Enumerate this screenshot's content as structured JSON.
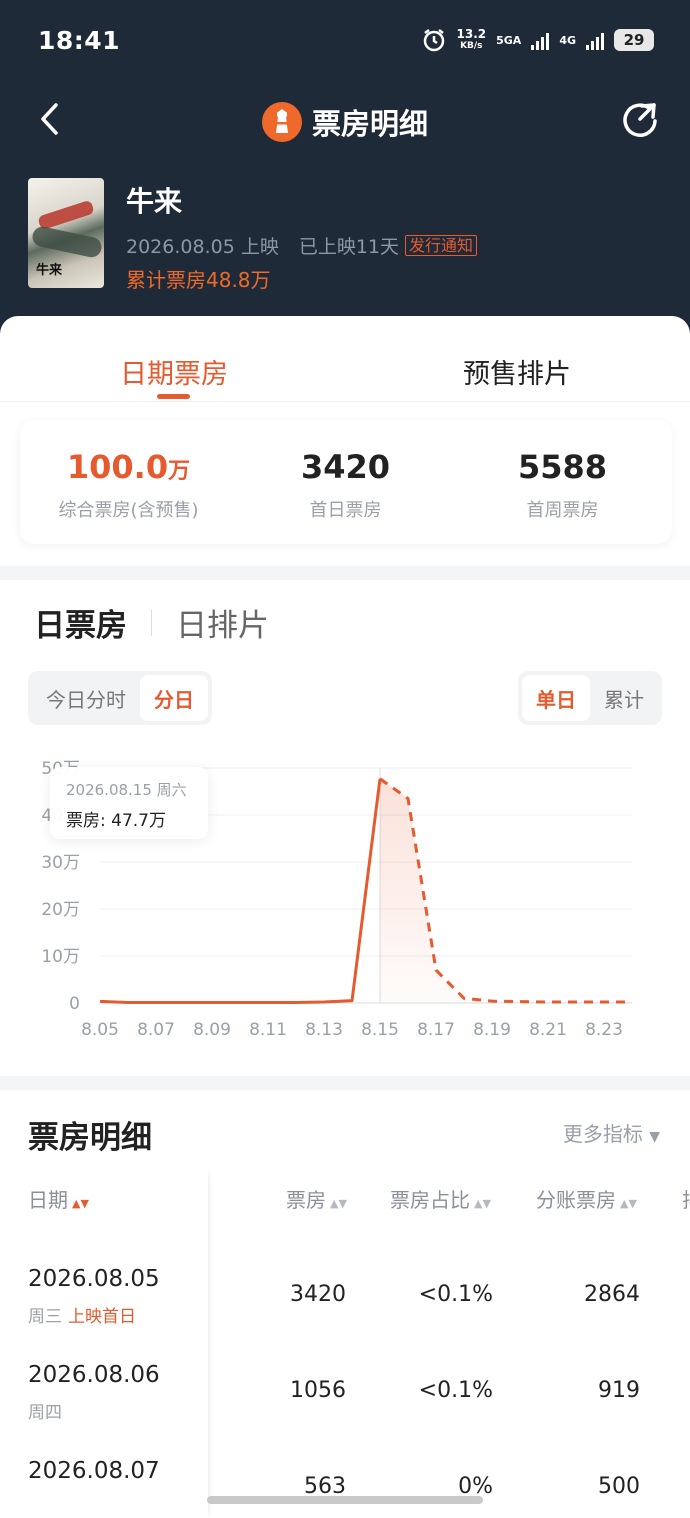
{
  "status_bar": {
    "time": "18:41",
    "speed_value": "13.2",
    "speed_unit": "KB/s",
    "network1": "5GA",
    "network2": "4G",
    "battery": "29"
  },
  "nav": {
    "title": "票房明细"
  },
  "movie": {
    "name": "牛来",
    "release": "2026.08.05 上映",
    "days": "已上映11天",
    "notice": "发行通知",
    "total": "累计票房48.8万",
    "poster_text": "牛来"
  },
  "tabs": {
    "active": "日期票房",
    "inactive": "预售排片"
  },
  "stats": [
    {
      "value": "100.0",
      "unit": "万",
      "label": "综合票房(含预售)"
    },
    {
      "value": "3420",
      "unit": "",
      "label": "首日票房"
    },
    {
      "value": "5588",
      "unit": "",
      "label": "首周票房"
    }
  ],
  "chart_tabs": {
    "a": "日票房",
    "b": "日排片"
  },
  "seg_left": [
    "今日分时",
    "分日"
  ],
  "seg_right": [
    "单日",
    "累计"
  ],
  "tooltip": {
    "date": "2026.08.15 周六",
    "value": "票房: 47.7万"
  },
  "chart_data": {
    "type": "line",
    "y_tick_labels": [
      "0",
      "10万",
      "20万",
      "30万",
      "40万",
      "50万"
    ],
    "ylim": [
      0,
      50
    ],
    "x_tick_labels": [
      "8.05",
      "8.07",
      "8.09",
      "8.11",
      "8.13",
      "8.15",
      "8.17",
      "8.19",
      "8.21",
      "8.23"
    ],
    "x": [
      "8.05",
      "8.06",
      "8.07",
      "8.08",
      "8.09",
      "8.10",
      "8.11",
      "8.12",
      "8.13",
      "8.14",
      "8.15",
      "8.16",
      "8.17",
      "8.18",
      "8.19",
      "8.20",
      "8.21",
      "8.22",
      "8.23",
      "8.24"
    ],
    "series": [
      {
        "values": [
          0.34,
          0.11,
          0.1,
          0.1,
          0.1,
          0.1,
          0.1,
          0.1,
          0.2,
          0.5,
          47.7,
          null,
          null,
          null,
          null,
          null,
          null,
          null,
          null,
          null
        ],
        "style": "solid",
        "color": "#e55a2e"
      },
      {
        "values": [
          null,
          null,
          null,
          null,
          null,
          null,
          null,
          null,
          null,
          null,
          47.7,
          43.5,
          7.0,
          1.0,
          0.4,
          0.3,
          0.2,
          0.2,
          0.2,
          0.2
        ],
        "style": "dashed",
        "color": "#e55a2e"
      }
    ],
    "highlight_x": "8.15",
    "grid": true
  },
  "table": {
    "title": "票房明细",
    "more": "更多指标",
    "headers": [
      "日期",
      "票房",
      "票房占比",
      "分账票房",
      "排"
    ],
    "rows": [
      {
        "date": "2026.08.05",
        "week": "周三",
        "tag": "上映首日",
        "box": "3420",
        "ratio": "<0.1%",
        "split": "2864"
      },
      {
        "date": "2026.08.06",
        "week": "周四",
        "tag": "",
        "box": "1056",
        "ratio": "<0.1%",
        "split": "919"
      },
      {
        "date": "2026.08.07",
        "week": "",
        "tag": "",
        "box": "563",
        "ratio": "0%",
        "split": "500"
      }
    ]
  },
  "colors": {
    "header_bg": "#1f2a38",
    "accent": "#e55a2e",
    "orange": "#ef6a2a"
  }
}
